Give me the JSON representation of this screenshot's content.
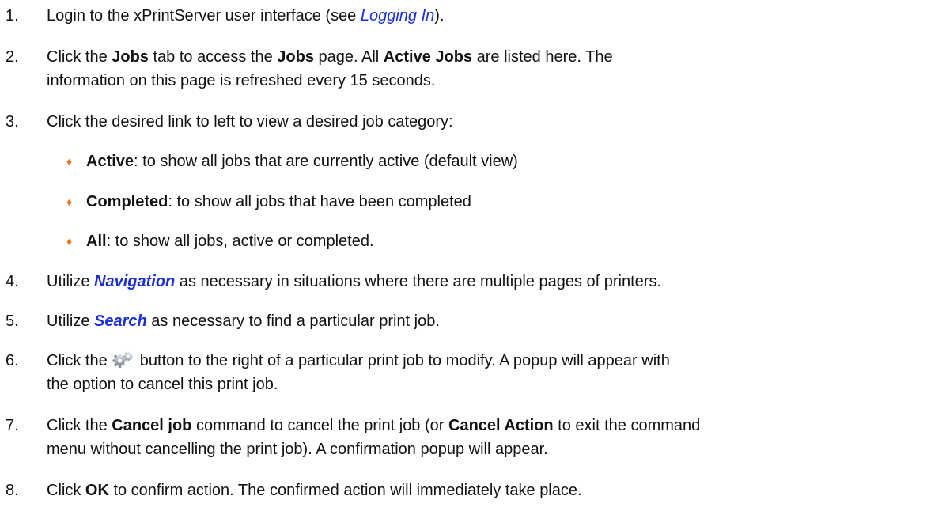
{
  "steps": [
    {
      "num": "1.",
      "parts": [
        "Login to the xPrintServer user interface (see ",
        "Logging In",
        ")."
      ]
    },
    {
      "num": "2.",
      "line1": [
        "Click the ",
        "Jobs",
        " tab to access the ",
        "Jobs",
        " page.  All ",
        "Active Jobs",
        " are listed here.  The"
      ],
      "line2": "information on this page is refreshed every 15 seconds."
    },
    {
      "num": "3.",
      "line1": "Click the desired link to left to view a desired job category:",
      "bullets": [
        {
          "bold": "Active",
          "rest": ": to show all jobs that are currently active (default view)"
        },
        {
          "bold": "Completed",
          "rest": ":  to show all jobs that have been completed"
        },
        {
          "bold": "All",
          "rest": ": to show all jobs, active or completed."
        }
      ]
    },
    {
      "num": "4.",
      "parts": [
        "Utilize ",
        "Navigation",
        " as necessary in situations where there are multiple pages of printers."
      ]
    },
    {
      "num": "5.",
      "parts": [
        "Utilize ",
        "Search",
        " as necessary to find a particular print job."
      ]
    },
    {
      "num": "6.",
      "line1_before": "Click the ",
      "line1_after": " button to the right of a particular print job to modify.  A popup will appear with",
      "line2": "the option to cancel this print job."
    },
    {
      "num": "7.",
      "line1": [
        "Click the ",
        "Cancel job",
        " command to cancel the print job (or ",
        "Cancel Action",
        " to exit the command"
      ],
      "line2": "menu without cancelling the print job).  A confirmation popup will appear."
    },
    {
      "num": "8.",
      "parts": [
        "Click ",
        "OK",
        " to confirm action.  The confirmed action will immediately take place."
      ]
    }
  ],
  "icons": {
    "gear": "gear-icon",
    "bullet": "diamond-bullet-icon",
    "bullet_char": "♦"
  },
  "colors": {
    "link": "#1a2fd6",
    "bullet": "#e8731a",
    "text": "#111111"
  }
}
